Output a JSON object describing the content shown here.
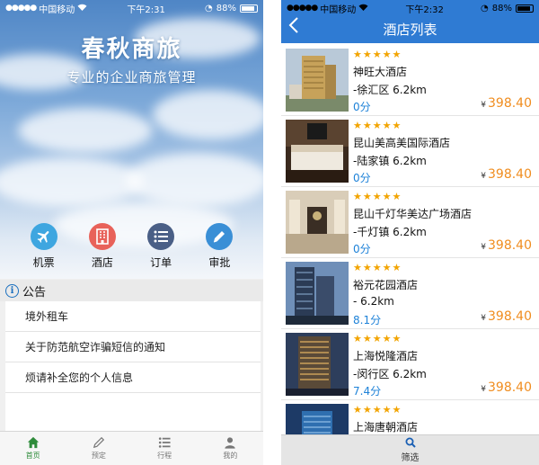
{
  "left_screen": {
    "status": {
      "carrier": "中国移动",
      "time": "下午2:31",
      "battery": "88%"
    },
    "brand": {
      "title": "春秋商旅",
      "slogan": "专业的企业商旅管理"
    },
    "features": [
      {
        "label": "机票",
        "icon": "airplane-icon",
        "color": "#3ea6e0"
      },
      {
        "label": "酒店",
        "icon": "hotel-icon",
        "color": "#e8625a"
      },
      {
        "label": "订单",
        "icon": "list-icon",
        "color": "#4a5f86"
      },
      {
        "label": "审批",
        "icon": "pencil-icon",
        "color": "#3a8fd6"
      }
    ],
    "notice": {
      "title": "公告",
      "items": [
        "境外租车",
        "关于防范航空诈骗短信的通知",
        "烦请补全您的个人信息"
      ]
    },
    "tabs": [
      {
        "label": "首页",
        "icon": "home-icon",
        "active": true
      },
      {
        "label": "预定",
        "icon": "pen-icon",
        "active": false
      },
      {
        "label": "行程",
        "icon": "itinerary-icon",
        "active": false
      },
      {
        "label": "我的",
        "icon": "user-icon",
        "active": false
      }
    ]
  },
  "right_screen": {
    "status": {
      "carrier": "中国移动",
      "time": "下午2:32",
      "battery": "88%"
    },
    "nav": {
      "title": "酒店列表",
      "back_icon": "chevron-left-icon"
    },
    "currency": "¥",
    "star_rating": "★★★★★",
    "hotels": [
      {
        "name": "神旺大酒店",
        "location": "-徐汇区  6.2km",
        "score": "0分",
        "price": "398.40"
      },
      {
        "name": "昆山美高美国际酒店",
        "location": "-陆家镇  6.2km",
        "score": "0分",
        "price": "398.40"
      },
      {
        "name": "昆山千灯华美达广场酒店",
        "location": "-千灯镇  6.2km",
        "score": "0分",
        "price": "398.40"
      },
      {
        "name": "裕元花园酒店",
        "location": "-  6.2km",
        "score": "8.1分",
        "price": "398.40"
      },
      {
        "name": "上海悦隆酒店",
        "location": "-闵行区  6.2km",
        "score": "7.4分",
        "price": "398.40"
      },
      {
        "name": "上海唐朝酒店",
        "location": "",
        "score": "",
        "price": ""
      }
    ],
    "filter": {
      "label": "筛选",
      "icon": "search-icon"
    }
  }
}
